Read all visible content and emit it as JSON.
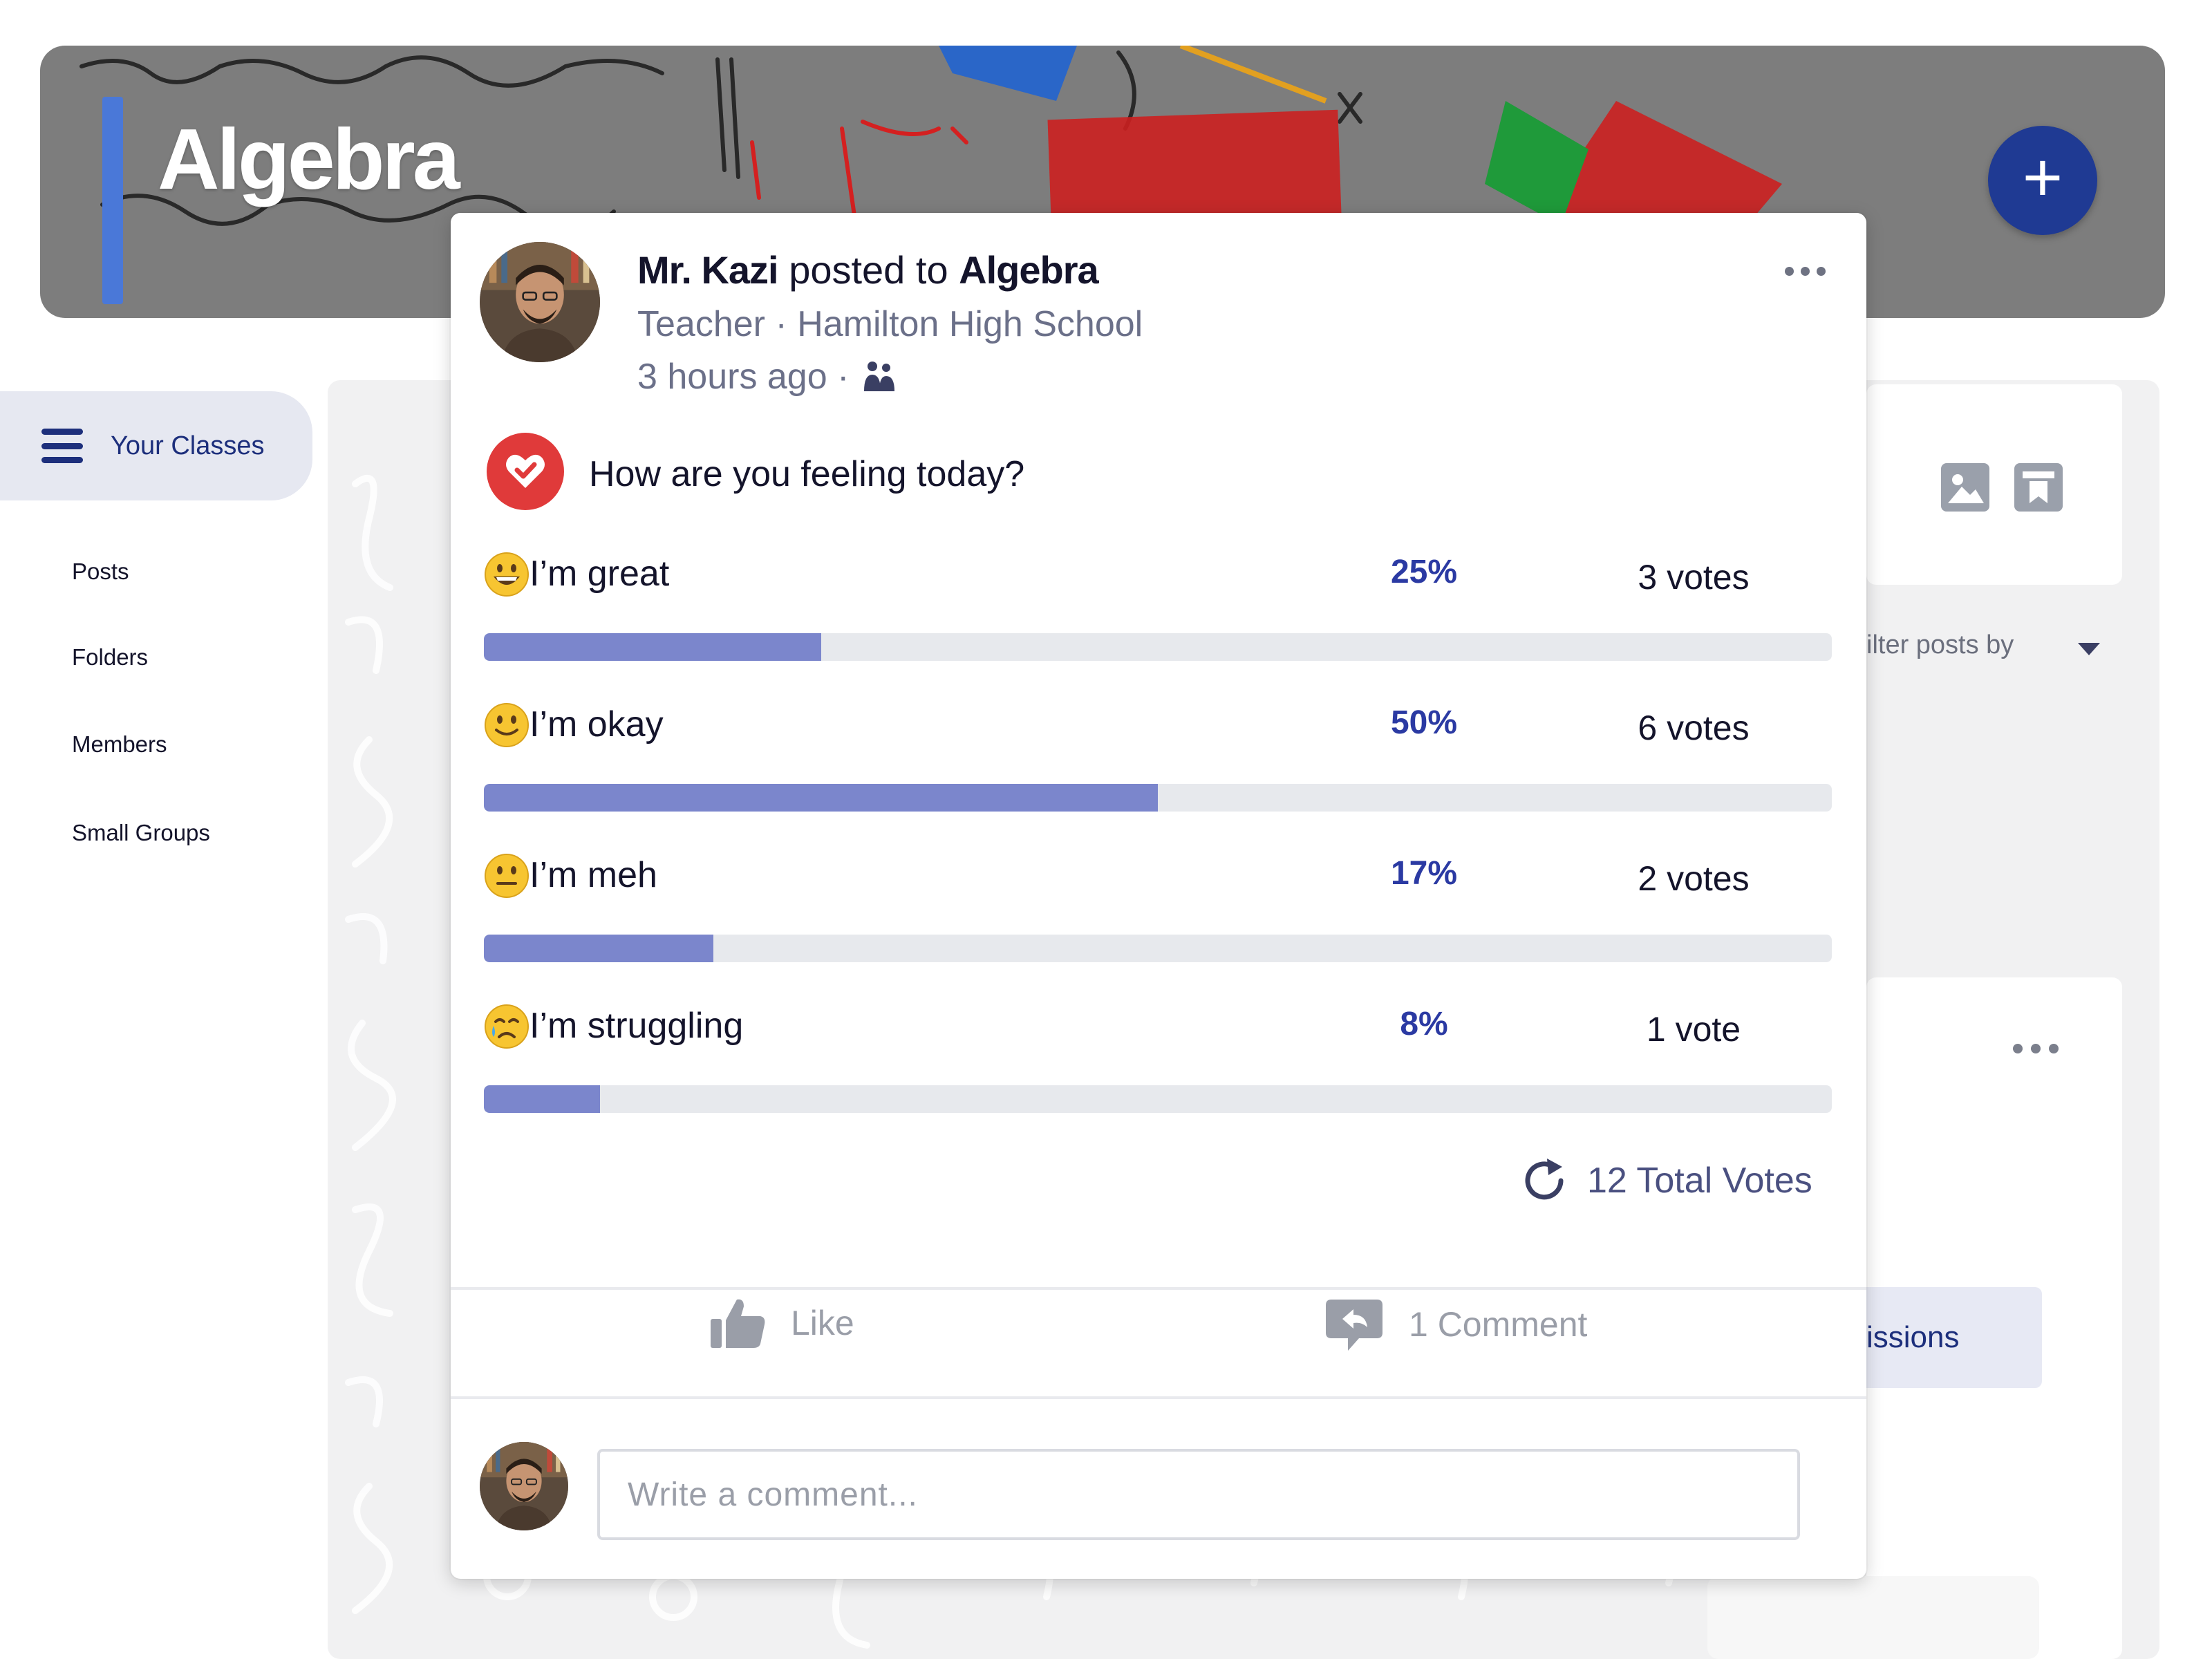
{
  "banner": {
    "title": "Algebra",
    "add_button_label": "+"
  },
  "sidebar": {
    "your_classes_label": "Your Classes",
    "items": [
      {
        "label": "Posts"
      },
      {
        "label": "Folders"
      },
      {
        "label": "Members"
      },
      {
        "label": "Small Groups"
      }
    ]
  },
  "right_panel": {
    "filter_text": "ilter posts by",
    "button_partial_label": "issions"
  },
  "post": {
    "author": "Mr. Kazi",
    "posted_to_text": "posted to",
    "class_name": "Algebra",
    "author_role": "Teacher · Hamilton High School",
    "time_ago": "3 hours ago ·",
    "question": "How are you feeling today?",
    "options": [
      {
        "emoji": "grinning-face",
        "label": "I’m great",
        "percent_text": "25%",
        "votes_text": "3 votes",
        "fraction": 0.25
      },
      {
        "emoji": "slightly-smiling-face",
        "label": "I’m okay",
        "percent_text": "50%",
        "votes_text": "6 votes",
        "fraction": 0.5
      },
      {
        "emoji": "neutral-face",
        "label": "I’m meh",
        "percent_text": "17%",
        "votes_text": "2 votes",
        "fraction": 0.17
      },
      {
        "emoji": "crying-face",
        "label": "I’m struggling",
        "percent_text": "8%",
        "votes_text": "1 vote",
        "fraction": 0.086
      }
    ],
    "total_votes": "12 Total Votes",
    "like_label": "Like",
    "comment_label": "1 Comment",
    "comment_placeholder": "Write a comment..."
  },
  "colors": {
    "accent": "#1f3a93",
    "poll_bar": "#7b86cc",
    "poll_track": "#e7e9ed",
    "percent_text": "#2b3aa3",
    "poll_icon": "#e03a3a"
  }
}
